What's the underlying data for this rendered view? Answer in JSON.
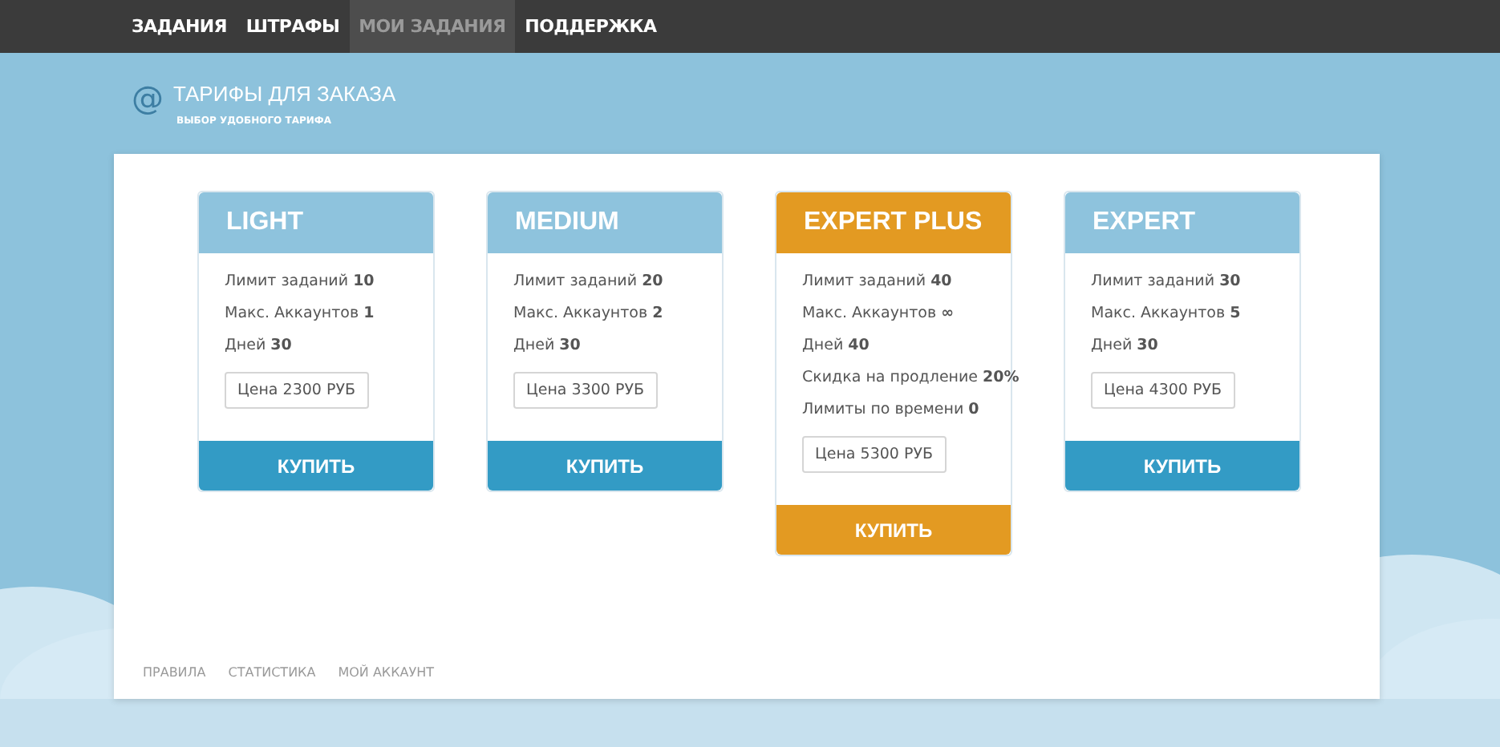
{
  "nav": [
    {
      "label": "ЗАДАНИЯ",
      "selected": false
    },
    {
      "label": "ШТРАФЫ",
      "selected": false
    },
    {
      "label": "МОИ ЗАДАНИЯ",
      "selected": true
    },
    {
      "label": "ПОДДЕРЖКА",
      "selected": false
    }
  ],
  "header": {
    "icon": "@",
    "title": "ТАРИФЫ ДЛЯ ЗАКАЗА",
    "subtitle": "ВЫБОР УДОБНОГО ТАРИФА"
  },
  "plans": [
    {
      "name": "LIGHT",
      "featured": false,
      "features": [
        "Лимит заданий **10**",
        "Макс. Аккаунтов **1**",
        "Дней **30**"
      ],
      "price": "Цена 2300 РУБ",
      "button": "КУПИТЬ"
    },
    {
      "name": "MEDIUM",
      "featured": false,
      "features": [
        "Лимит заданий **20**",
        "Макс. Аккаунтов **2**",
        "Дней **30**"
      ],
      "price": "Цена 3300 РУБ",
      "button": "КУПИТЬ"
    },
    {
      "name": "EXPERT PLUS",
      "featured": true,
      "features": [
        "Лимит заданий **40**",
        "Макс. Аккаунтов **∞**",
        "Дней **40**",
        "Скидка на продление **20%**",
        "Лимиты по времени **0**"
      ],
      "price": "Цена 5300 РУБ",
      "button": "КУПИТЬ"
    },
    {
      "name": "EXPERT",
      "featured": false,
      "features": [
        "Лимит заданий **30**",
        "Макс. Аккаунтов **5**",
        "Дней **30**"
      ],
      "price": "Цена 4300 РУБ",
      "button": "КУПИТЬ"
    }
  ],
  "footer_links": [
    "ПРАВИЛА",
    "СТАТИСТИКА",
    "МОЙ АККАУНТ"
  ]
}
